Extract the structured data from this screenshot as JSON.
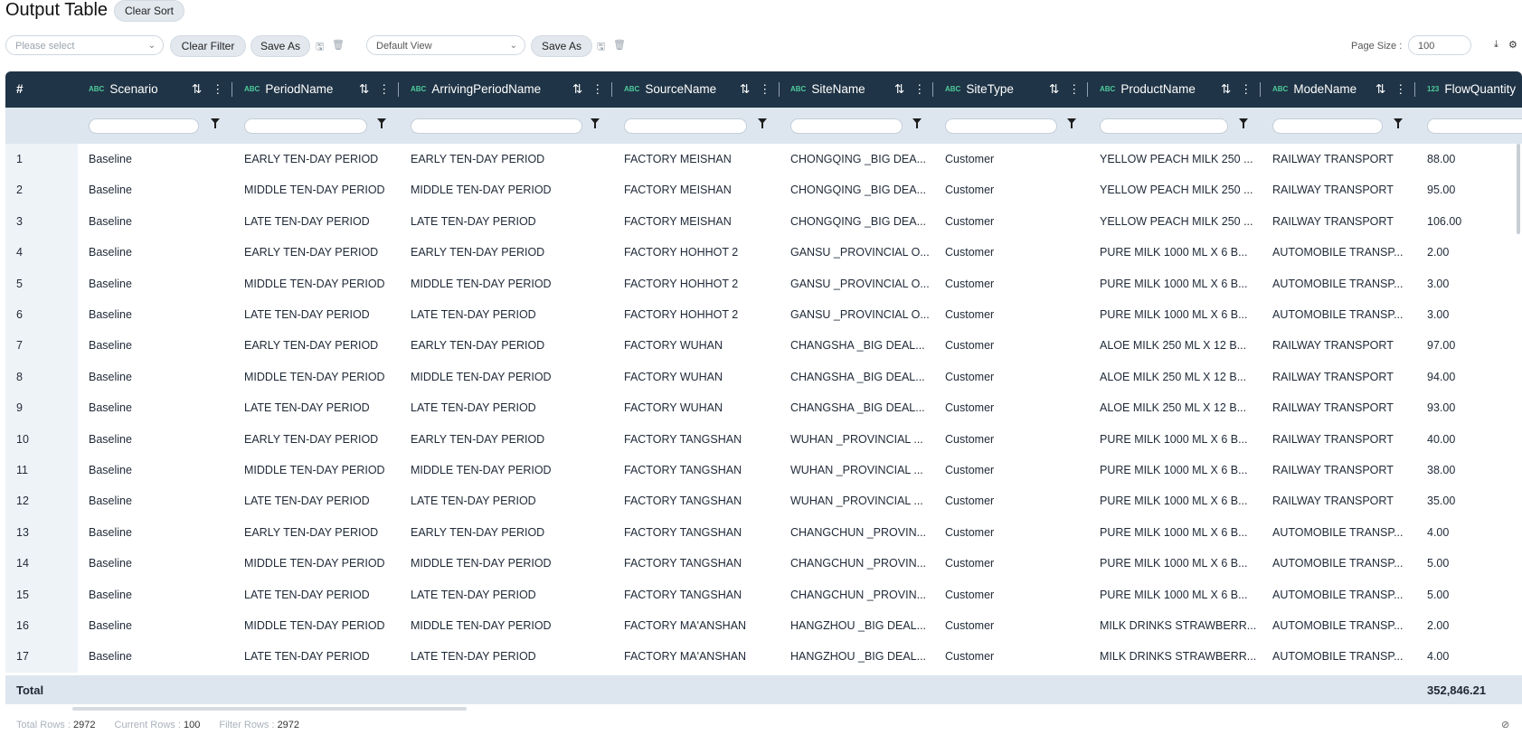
{
  "page": {
    "title": "Output Table",
    "clear_sort": "Clear Sort"
  },
  "toolbar": {
    "filter_placeholder": "Please select",
    "clear_filter": "Clear Filter",
    "save_as_1": "Save As",
    "view_value": "Default View",
    "save_as_2": "Save As",
    "page_size_label": "Page Size :",
    "page_size_value": "100"
  },
  "columns": [
    {
      "label": "#",
      "type": ""
    },
    {
      "label": "Scenario",
      "type": "ABC"
    },
    {
      "label": "PeriodName",
      "type": "ABC"
    },
    {
      "label": "ArrivingPeriodName",
      "type": "ABC"
    },
    {
      "label": "SourceName",
      "type": "ABC"
    },
    {
      "label": "SiteName",
      "type": "ABC"
    },
    {
      "label": "SiteType",
      "type": "ABC"
    },
    {
      "label": "ProductName",
      "type": "ABC"
    },
    {
      "label": "ModeName",
      "type": "ABC"
    },
    {
      "label": "FlowQuantity",
      "type": "123"
    }
  ],
  "rows": [
    [
      "1",
      "Baseline",
      "EARLY TEN-DAY PERIOD",
      "EARLY TEN-DAY PERIOD",
      "FACTORY MEISHAN",
      "CHONGQING _BIG DEA...",
      "Customer",
      "YELLOW PEACH MILK 250 ...",
      "RAILWAY TRANSPORT",
      "88.00"
    ],
    [
      "2",
      "Baseline",
      "MIDDLE TEN-DAY PERIOD",
      "MIDDLE TEN-DAY PERIOD",
      "FACTORY MEISHAN",
      "CHONGQING _BIG DEA...",
      "Customer",
      "YELLOW PEACH MILK 250 ...",
      "RAILWAY TRANSPORT",
      "95.00"
    ],
    [
      "3",
      "Baseline",
      "LATE TEN-DAY PERIOD",
      "LATE TEN-DAY PERIOD",
      "FACTORY MEISHAN",
      "CHONGQING _BIG DEA...",
      "Customer",
      "YELLOW PEACH MILK 250 ...",
      "RAILWAY TRANSPORT",
      "106.00"
    ],
    [
      "4",
      "Baseline",
      "EARLY TEN-DAY PERIOD",
      "EARLY TEN-DAY PERIOD",
      "FACTORY HOHHOT 2",
      "GANSU _PROVINCIAL O...",
      "Customer",
      "PURE MILK 1000 ML X 6 B...",
      "AUTOMOBILE TRANSP...",
      "2.00"
    ],
    [
      "5",
      "Baseline",
      "MIDDLE TEN-DAY PERIOD",
      "MIDDLE TEN-DAY PERIOD",
      "FACTORY HOHHOT 2",
      "GANSU _PROVINCIAL O...",
      "Customer",
      "PURE MILK 1000 ML X 6 B...",
      "AUTOMOBILE TRANSP...",
      "3.00"
    ],
    [
      "6",
      "Baseline",
      "LATE TEN-DAY PERIOD",
      "LATE TEN-DAY PERIOD",
      "FACTORY HOHHOT 2",
      "GANSU _PROVINCIAL O...",
      "Customer",
      "PURE MILK 1000 ML X 6 B...",
      "AUTOMOBILE TRANSP...",
      "3.00"
    ],
    [
      "7",
      "Baseline",
      "EARLY TEN-DAY PERIOD",
      "EARLY TEN-DAY PERIOD",
      "FACTORY WUHAN",
      "CHANGSHA _BIG DEAL...",
      "Customer",
      "ALOE MILK 250 ML X 12 B...",
      "RAILWAY TRANSPORT",
      "97.00"
    ],
    [
      "8",
      "Baseline",
      "MIDDLE TEN-DAY PERIOD",
      "MIDDLE TEN-DAY PERIOD",
      "FACTORY WUHAN",
      "CHANGSHA _BIG DEAL...",
      "Customer",
      "ALOE MILK 250 ML X 12 B...",
      "RAILWAY TRANSPORT",
      "94.00"
    ],
    [
      "9",
      "Baseline",
      "LATE TEN-DAY PERIOD",
      "LATE TEN-DAY PERIOD",
      "FACTORY WUHAN",
      "CHANGSHA _BIG DEAL...",
      "Customer",
      "ALOE MILK 250 ML X 12 B...",
      "RAILWAY TRANSPORT",
      "93.00"
    ],
    [
      "10",
      "Baseline",
      "EARLY TEN-DAY PERIOD",
      "EARLY TEN-DAY PERIOD",
      "FACTORY TANGSHAN",
      "WUHAN _PROVINCIAL ...",
      "Customer",
      "PURE MILK 1000 ML X 6 B...",
      "RAILWAY TRANSPORT",
      "40.00"
    ],
    [
      "11",
      "Baseline",
      "MIDDLE TEN-DAY PERIOD",
      "MIDDLE TEN-DAY PERIOD",
      "FACTORY TANGSHAN",
      "WUHAN _PROVINCIAL ...",
      "Customer",
      "PURE MILK 1000 ML X 6 B...",
      "RAILWAY TRANSPORT",
      "38.00"
    ],
    [
      "12",
      "Baseline",
      "LATE TEN-DAY PERIOD",
      "LATE TEN-DAY PERIOD",
      "FACTORY TANGSHAN",
      "WUHAN _PROVINCIAL ...",
      "Customer",
      "PURE MILK 1000 ML X 6 B...",
      "RAILWAY TRANSPORT",
      "35.00"
    ],
    [
      "13",
      "Baseline",
      "EARLY TEN-DAY PERIOD",
      "EARLY TEN-DAY PERIOD",
      "FACTORY TANGSHAN",
      "CHANGCHUN _PROVIN...",
      "Customer",
      "PURE MILK 1000 ML X 6 B...",
      "AUTOMOBILE TRANSP...",
      "4.00"
    ],
    [
      "14",
      "Baseline",
      "MIDDLE TEN-DAY PERIOD",
      "MIDDLE TEN-DAY PERIOD",
      "FACTORY TANGSHAN",
      "CHANGCHUN _PROVIN...",
      "Customer",
      "PURE MILK 1000 ML X 6 B...",
      "AUTOMOBILE TRANSP...",
      "5.00"
    ],
    [
      "15",
      "Baseline",
      "LATE TEN-DAY PERIOD",
      "LATE TEN-DAY PERIOD",
      "FACTORY TANGSHAN",
      "CHANGCHUN _PROVIN...",
      "Customer",
      "PURE MILK 1000 ML X 6 B...",
      "AUTOMOBILE TRANSP...",
      "5.00"
    ],
    [
      "16",
      "Baseline",
      "MIDDLE TEN-DAY PERIOD",
      "MIDDLE TEN-DAY PERIOD",
      "FACTORY MA'ANSHAN",
      "HANGZHOU _BIG DEAL...",
      "Customer",
      "MILK DRINKS STRAWBERR...",
      "AUTOMOBILE TRANSP...",
      "2.00"
    ],
    [
      "17",
      "Baseline",
      "LATE TEN-DAY PERIOD",
      "LATE TEN-DAY PERIOD",
      "FACTORY MA'ANSHAN",
      "HANGZHOU _BIG DEAL...",
      "Customer",
      "MILK DRINKS STRAWBERR...",
      "AUTOMOBILE TRANSP...",
      "4.00"
    ]
  ],
  "total": {
    "label": "Total",
    "value": "352,846.21"
  },
  "footer": {
    "total_rows_label": "Total Rows :",
    "total_rows": "2972",
    "current_rows_label": "Current Rows :",
    "current_rows": "100",
    "filter_rows_label": "Filter Rows :",
    "filter_rows": "2972"
  },
  "colors": {
    "header_bg": "#1f3446",
    "filter_bg": "#dde6ee",
    "accent": "#4ecb9b"
  }
}
